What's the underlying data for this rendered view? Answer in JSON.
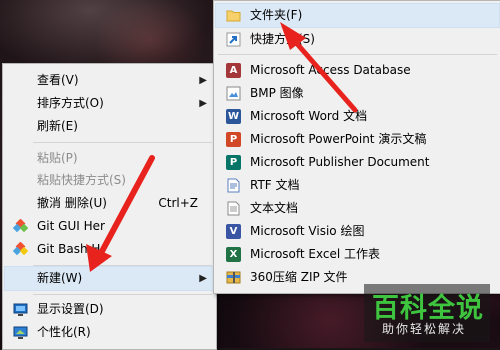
{
  "colors": {
    "annotation_arrow": "#e8231d",
    "watermark_green": "#3ec43e",
    "menu_bg": "#f0f0f0",
    "highlight": "#dbe9f6",
    "access": "#a4373a",
    "word": "#2b579a",
    "powerpoint": "#d24726",
    "publisher": "#077568",
    "excel": "#217346",
    "visio": "#3955a3"
  },
  "context_menu": {
    "items": [
      {
        "label": "查看(V)",
        "icon": "",
        "has_submenu": true
      },
      {
        "label": "排序方式(O)",
        "icon": "",
        "has_submenu": true
      },
      {
        "label": "刷新(E)",
        "icon": ""
      },
      {
        "label": "粘贴(P)",
        "icon": "",
        "disabled": true
      },
      {
        "label": "粘贴快捷方式(S)",
        "icon": "",
        "disabled": true
      },
      {
        "label": "撤消 删除(U)",
        "shortcut": "Ctrl+Z"
      },
      {
        "label": "Git GUI Her",
        "icon": "git-gui-icon"
      },
      {
        "label": "Git Bash H",
        "icon": "git-bash-icon"
      },
      {
        "label": "新建(W)",
        "has_submenu": true,
        "highlighted": true
      },
      {
        "label": "显示设置(D)",
        "icon": "display-settings-icon"
      },
      {
        "label": "个性化(R)",
        "icon": "personalize-icon"
      }
    ]
  },
  "new_submenu": {
    "items": [
      {
        "label": "文件夹(F)",
        "icon": "folder-icon"
      },
      {
        "label": "快捷方式(S)",
        "icon": "shortcut-icon"
      },
      {
        "label": "Microsoft Access Database",
        "icon": "access-icon",
        "badge": "A"
      },
      {
        "label": "BMP 图像",
        "icon": "bmp-image-icon"
      },
      {
        "label": "Microsoft Word 文档",
        "icon": "word-icon",
        "badge": "W"
      },
      {
        "label": "Microsoft PowerPoint 演示文稿",
        "icon": "powerpoint-icon",
        "badge": "P"
      },
      {
        "label": "Microsoft Publisher Document",
        "icon": "publisher-icon",
        "badge": "P"
      },
      {
        "label": "RTF 文档",
        "icon": "rtf-document-icon"
      },
      {
        "label": "文本文档",
        "icon": "text-document-icon"
      },
      {
        "label": "Microsoft Visio 绘图",
        "icon": "visio-icon",
        "badge": "V"
      },
      {
        "label": "Microsoft Excel 工作表",
        "icon": "excel-icon",
        "badge": "X"
      },
      {
        "label": "360压缩 ZIP 文件",
        "icon": "zip-archive-icon"
      }
    ]
  },
  "watermark": {
    "title": "百科全说",
    "subtitle": "助你轻松解决"
  }
}
